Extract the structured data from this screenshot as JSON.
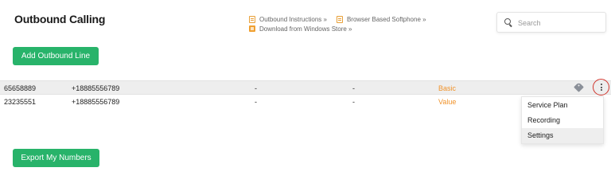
{
  "header": {
    "title": "Outbound Calling"
  },
  "links": {
    "outbound_instructions": "Outbound Instructions »",
    "browser_softphone": "Browser Based Softphone »",
    "windows_store": "Download from Windows Store »"
  },
  "search": {
    "placeholder": "Search",
    "value": ""
  },
  "buttons": {
    "add_line": "Add Outbound Line",
    "export": "Export My Numbers"
  },
  "rows": [
    {
      "number": "65658889",
      "caller_id": "+18885556789",
      "col3": "-",
      "col4": "-",
      "plan": "Basic",
      "highlighted": true
    },
    {
      "number": "23235551",
      "caller_id": "+18885556789",
      "col3": "-",
      "col4": "-",
      "plan": "Value",
      "highlighted": false
    }
  ],
  "context_menu": {
    "items": [
      "Service Plan",
      "Recording",
      "Settings"
    ],
    "hovered": "Settings"
  },
  "icons": {
    "tag": "tag-icon",
    "more": "more-vertical-icon",
    "search": "search-icon",
    "doc": "document-icon",
    "windows": "windows-icon"
  },
  "colors": {
    "accent_green": "#28b36a",
    "plan_orange": "#f0932b",
    "link_icon_orange": "#e8a038",
    "highlight_ring": "#d0342c"
  }
}
